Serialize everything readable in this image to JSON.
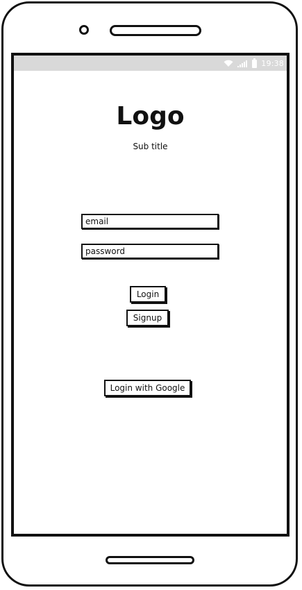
{
  "status_bar": {
    "time": "19:38",
    "icons": [
      "wifi-icon",
      "signal-icon",
      "battery-icon"
    ],
    "background": "#d9d9d9"
  },
  "branding": {
    "logo": "Logo",
    "subtitle": "Sub title"
  },
  "form": {
    "email_placeholder": "email",
    "password_placeholder": "password"
  },
  "buttons": {
    "login": "Login",
    "signup": "Signup",
    "google": "Login with Google"
  },
  "colors": {
    "ink": "#111111",
    "paper": "#ffffff",
    "status_bar": "#d9d9d9"
  }
}
